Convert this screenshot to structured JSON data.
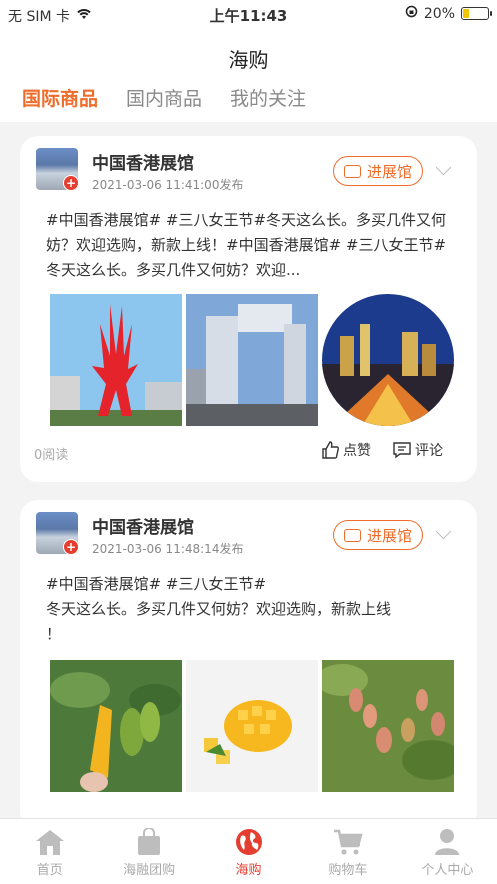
{
  "status": {
    "carrier": "无 SIM 卡",
    "time": "上午11:43",
    "battery": "20%"
  },
  "header": {
    "title": "海购"
  },
  "tabs": [
    {
      "label": "国际商品",
      "active": true
    },
    {
      "label": "国内商品",
      "active": false
    },
    {
      "label": "我的关注",
      "active": false
    }
  ],
  "posts": [
    {
      "hall": "中国香港展馆",
      "time": "2021-03-06 11:41:00发布",
      "button": "进展馆",
      "text": "#中国香港展馆# #三八女王节#冬天这么长。多买几件又何妨？欢迎选购，新款上线！#中国香港展馆# #三八女王节#冬天这么长。多买几件又何妨？欢迎...",
      "reads": "0阅读",
      "like": "点赞",
      "comment": "评论"
    },
    {
      "hall": "中国香港展馆",
      "time": "2021-03-06 11:48:14发布",
      "button": "进展馆",
      "text": "#中国香港展馆# #三八女王节#\n冬天这么长。多买几件又何妨？欢迎选购，新款上线\n！"
    }
  ],
  "tabbar": [
    {
      "label": "首页",
      "icon": "home-icon"
    },
    {
      "label": "海融团购",
      "icon": "shopping-bag-icon"
    },
    {
      "label": "海购",
      "icon": "globe-icon",
      "active": true
    },
    {
      "label": "购物车",
      "icon": "cart-icon"
    },
    {
      "label": "个人中心",
      "icon": "person-icon"
    }
  ],
  "colors": {
    "accent": "#ef6d2c",
    "active_tab": "#e53d2f"
  }
}
